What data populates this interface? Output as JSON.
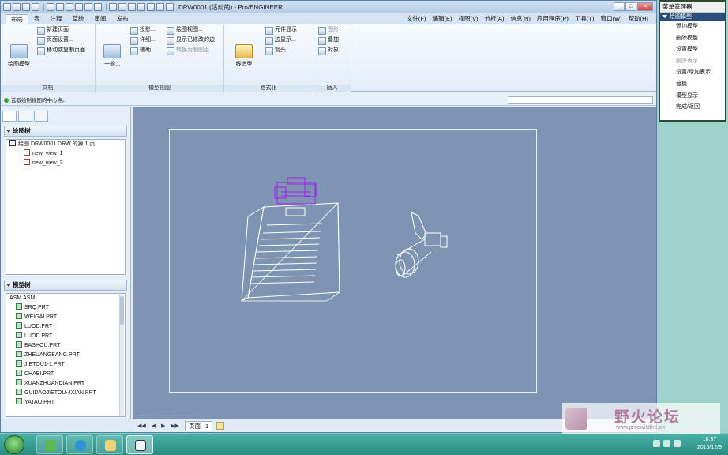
{
  "window": {
    "title": "DRW0001 (活动的) - Pro/ENGINEER"
  },
  "tabs": [
    "布局",
    "表",
    "注释",
    "草绘",
    "审阅",
    "发布"
  ],
  "menus": [
    "文件(F)",
    "编辑(E)",
    "视图(V)",
    "分析(A)",
    "信息(N)",
    "应用程序(P)",
    "工具(T)",
    "窗口(W)",
    "帮助(H)"
  ],
  "ribbon": {
    "doc": {
      "label": "文档",
      "big": "绘图模型",
      "items": [
        "新建页面",
        "页面设置...",
        "移动或复制页面"
      ]
    },
    "views": {
      "label": "模型视图",
      "big": "一般...",
      "col1": [
        "投影...",
        "详细...",
        "辅助..."
      ],
      "col2": [
        "绘图视图...",
        "显示已修改的边",
        "转换为制图组"
      ]
    },
    "format": {
      "label": "格式化",
      "big": "线造型",
      "items": [
        "元件显示",
        "边显示...",
        "箭头"
      ]
    },
    "insert": {
      "label": "插入",
      "items": [
        "图形",
        "叠加",
        "对象..."
      ]
    }
  },
  "status": {
    "message": "选取绘制视图的中心点。"
  },
  "drawing_tree": {
    "title": "绘图树",
    "items": [
      "绘图 DRW0001.DRW 的第 1 页",
      "new_view_1",
      "new_view_2"
    ]
  },
  "model_tree": {
    "title": "模型树",
    "items": [
      "ASM.ASM",
      "SRQ.PRT",
      "WEIGAI.PRT",
      "LUOD.PRT",
      "LUOD.PRT",
      "BASHOU.PRT",
      "ZHEUANGBANG.PRT",
      "JIETOU1-1.PRT",
      "CHABI.PRT",
      "XUANZHUANDIAN.PRT",
      "GUIDAOJIETOU-4XIAN.PRT",
      "YATAO.PRT"
    ]
  },
  "pages": {
    "label": "页面",
    "number": "1"
  },
  "menu_manager": {
    "title": "菜单管理器",
    "header": "绘图模型",
    "items": [
      {
        "label": "添加模型",
        "enabled": true
      },
      {
        "label": "删除模型",
        "enabled": true
      },
      {
        "label": "设置模型",
        "enabled": true
      },
      {
        "label": "删除表示",
        "enabled": false
      },
      {
        "label": "设置/增加表示",
        "enabled": true
      },
      {
        "label": "替换",
        "enabled": true
      },
      {
        "label": "模型显示",
        "enabled": true
      },
      {
        "label": "完成/返回",
        "enabled": true
      }
    ]
  },
  "taskbar": {
    "time": "18:37",
    "date": "2016/12/9"
  },
  "watermark": {
    "text": "野火论坛",
    "url": "www.proewildfire.cn"
  },
  "colors": {
    "canvas": "#7d95b2",
    "highlight": "#a020f0",
    "taskbar": "#3aa197"
  }
}
